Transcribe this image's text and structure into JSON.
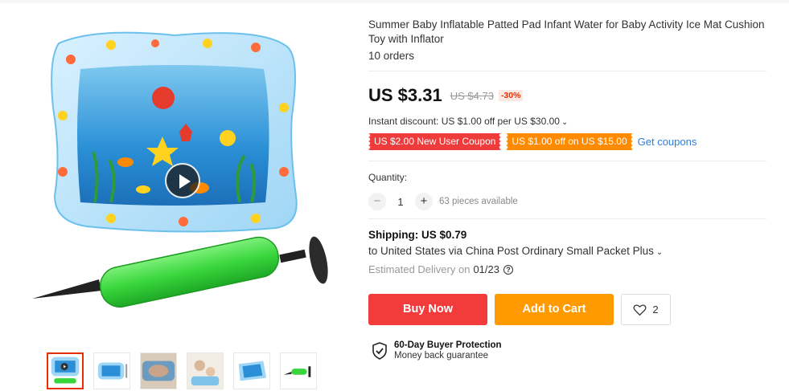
{
  "product": {
    "title": "Summer Baby Inflatable Patted Pad Infant Water for Baby Activity Ice Mat Cushion Toy with Inflator",
    "orders": "10 orders"
  },
  "price": {
    "current": "US $3.31",
    "original": "US $4.73",
    "discount_pct": "-30%"
  },
  "instant_discount": {
    "text": "Instant discount: US $1.00 off per US $30.00",
    "chevron": "⌄"
  },
  "coupons": {
    "items": [
      {
        "label": "US $2.00 New User Coupon",
        "color": "#ee3b3b"
      },
      {
        "label": "US $1.00 off on US $15.00",
        "color": "#ff8a00"
      }
    ],
    "get_label": "Get coupons"
  },
  "quantity": {
    "label": "Quantity:",
    "minus": "−",
    "value": "1",
    "plus": "+",
    "available": "63 pieces available"
  },
  "shipping": {
    "title": "Shipping: US $0.79",
    "route": "to United States via China Post Ordinary Small Packet Plus",
    "chevron": "⌄",
    "estimate_label": "Estimated Delivery on",
    "estimate_date": "01/23",
    "help_icon": "?"
  },
  "actions": {
    "buy_now": "Buy Now",
    "add_to_cart": "Add to Cart",
    "wishlist_count": "2"
  },
  "protection": {
    "title": "60-Day Buyer Protection",
    "subtitle": "Money back guarantee"
  },
  "gallery": {
    "thumbnail_count": 6,
    "active_thumbnail": 1
  },
  "colors": {
    "buy_now": "#f23c3c",
    "add_to_cart": "#ff9a00",
    "accent_red": "#e62e04",
    "link_blue": "#2e7dd7"
  },
  "icons": {
    "play": "play-icon",
    "heart": "heart-icon",
    "shield": "shield-check-icon",
    "help": "help-circle-icon"
  }
}
